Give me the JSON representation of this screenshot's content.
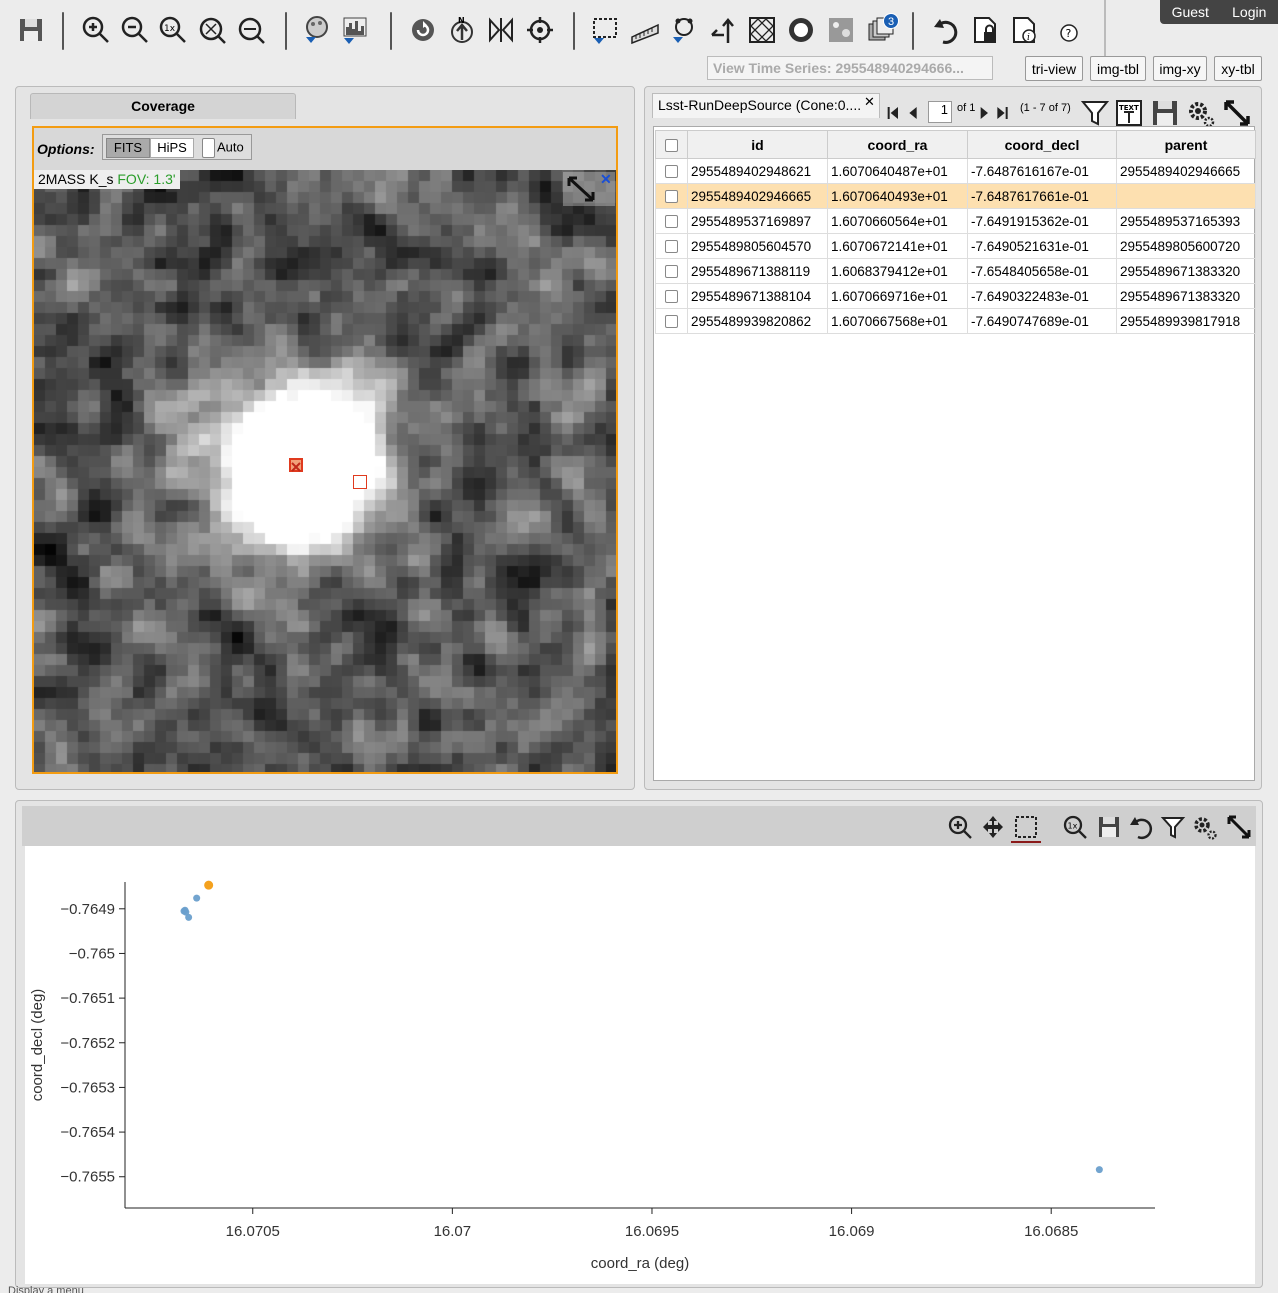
{
  "header": {
    "user": {
      "guest": "Guest",
      "login": "Login"
    },
    "time_series_button": "View Time Series: 295548940294666...",
    "views": [
      "tri-view",
      "img-tbl",
      "img-xy",
      "xy-tbl"
    ],
    "layers_badge": "3"
  },
  "toolbar_icons": [
    "save-icon",
    "zoom-in-icon",
    "zoom-out-icon",
    "zoom-1x-icon",
    "zoom-fit-icon",
    "zoom-fill-icon",
    "color-stretch-icon",
    "histogram-icon",
    "rotate-icon",
    "north-up-icon",
    "flip-icon",
    "recenter-icon",
    "select-area-icon",
    "distance-tool-icon",
    "overlay-select-icon",
    "directions-icon",
    "grid-icon",
    "mask-icon",
    "crop-icon",
    "layers-icon",
    "undo-icon",
    "lock-icon",
    "info-icon",
    "help-icon"
  ],
  "coverage": {
    "tab_label": "Coverage",
    "options_label": "Options:",
    "fits_label": "FITS",
    "hips_label": "HiPS",
    "auto_label": "Auto",
    "image_label": "2MASS K_s",
    "fov_label": "FOV: 1.3'"
  },
  "table": {
    "tab_title": "Lsst-RunDeepSource (Cone:0....",
    "page_value": "1",
    "page_of": "of 1",
    "range": "(1 - 7 of 7)",
    "columns": [
      "id",
      "coord_ra",
      "coord_decl",
      "parent"
    ],
    "rows": [
      [
        "2955489402948621",
        "1.6070640487e+01",
        "-7.6487616167e-01",
        "2955489402946665"
      ],
      [
        "2955489402946665",
        "1.6070640493e+01",
        "-7.6487617661e-01",
        ""
      ],
      [
        "2955489537169897",
        "1.6070660564e+01",
        "-7.6491915362e-01",
        "2955489537165393"
      ],
      [
        "2955489805604570",
        "1.6070672141e+01",
        "-7.6490521631e-01",
        "2955489805600720"
      ],
      [
        "2955489671388119",
        "1.6068379412e+01",
        "-7.6548405658e-01",
        "2955489671383320"
      ],
      [
        "2955489671388104",
        "1.6070669716e+01",
        "-7.6490322483e-01",
        "2955489671383320"
      ],
      [
        "2955489939820862",
        "1.6070667568e+01",
        "-7.6490747689e-01",
        "2955489939817918"
      ]
    ],
    "selected_row": 1
  },
  "chart_data": {
    "type": "scatter",
    "xlabel": "coord_ra (deg)",
    "ylabel": "coord_decl (deg)",
    "x_ticks": [
      "16.0705",
      "16.07",
      "16.0695",
      "16.069",
      "16.0685"
    ],
    "x_tick_values": [
      16.0705,
      16.07,
      16.0695,
      16.069,
      16.0685
    ],
    "y_ticks": [
      "−0.7649",
      "−0.765",
      "−0.7651",
      "−0.7652",
      "−0.7653",
      "−0.7654",
      "−0.7655"
    ],
    "y_tick_values": [
      -0.7649,
      -0.765,
      -0.7651,
      -0.7652,
      -0.7653,
      -0.7654,
      -0.7655
    ],
    "xlim": [
      16.07082,
      16.06824
    ],
    "ylim": [
      -0.76557,
      -0.76484
    ],
    "points": [
      {
        "x": 16.070640487,
        "y": -0.76487616167,
        "highlight": false
      },
      {
        "x": 16.070640493,
        "y": -0.76487617661,
        "highlight": true
      },
      {
        "x": 16.070660564,
        "y": -0.76491915362,
        "highlight": false
      },
      {
        "x": 16.070672141,
        "y": -0.76490521631,
        "highlight": false
      },
      {
        "x": 16.068379412,
        "y": -0.76548405658,
        "highlight": false
      },
      {
        "x": 16.070669716,
        "y": -0.76490322483,
        "highlight": false
      },
      {
        "x": 16.070667568,
        "y": -0.76490747689,
        "highlight": false
      }
    ],
    "colors": {
      "point": "#6a9fcc",
      "highlight": "#f39c12"
    }
  },
  "footer_text": "Display a menu"
}
